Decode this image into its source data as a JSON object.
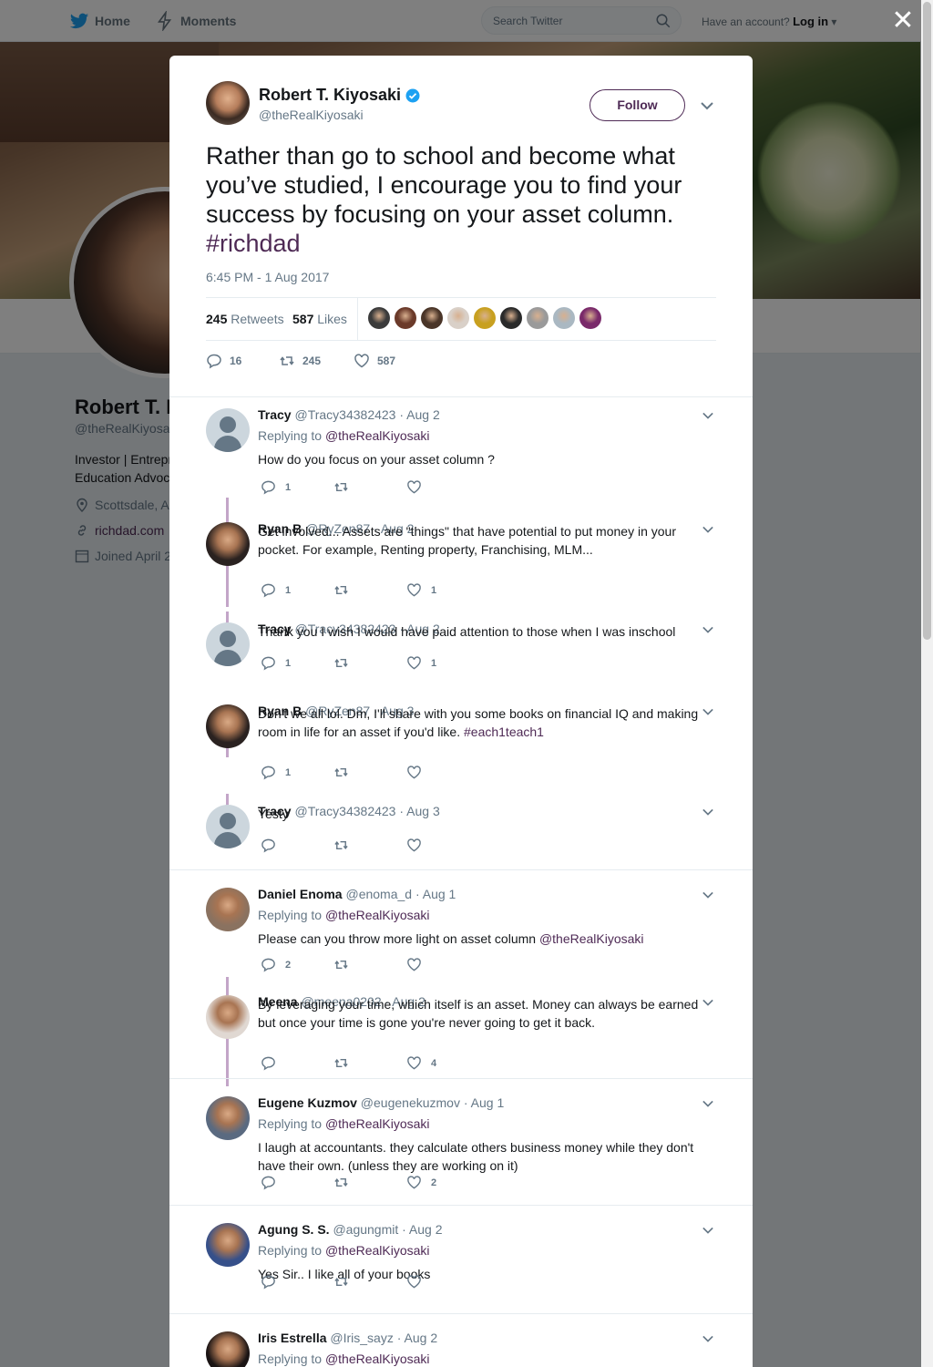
{
  "topbar": {
    "home": "Home",
    "moments": "Moments",
    "search_placeholder": "Search Twitter",
    "have_account": "Have an account?",
    "login": "Log in"
  },
  "profile": {
    "name": "Robert T. K",
    "handle": "@theRealKiyosal",
    "bio_line1": "Investor | Entrepr",
    "bio_line2": "Education Advoc",
    "location": "Scottsdale, A",
    "url": "richdad.com",
    "joined": "Joined April 2"
  },
  "main_tweet": {
    "name": "Robert T. Kiyosaki",
    "handle": "@theRealKiyosaki",
    "follow": "Follow",
    "text": "Rather than go to school and become what you’ve studied, I encourage you to find your success by focusing on your asset column.",
    "hashtag": "#richdad",
    "time": "6:45 PM - 1 Aug 2017",
    "retweets_count": "245",
    "retweets_label": "Retweets",
    "likes_count": "587",
    "likes_label": "Likes",
    "action_replies": "16",
    "action_retweets": "245",
    "action_likes": "587",
    "liker_colors": [
      "#3b3b3b",
      "#6b3a2a",
      "#4a3528",
      "#d9d0c8",
      "#c8a020",
      "#2a2a2a",
      "#9a9a9a",
      "#aab8c2",
      "#7a2a6a"
    ]
  },
  "replies": [
    {
      "name": "Tracy",
      "handle": "@Tracy34382423",
      "date": "· Aug 2",
      "replying_label": "Replying to",
      "replying_to": "@theRealKiyosaki",
      "text": "How do you focus on your asset column ?",
      "replies": "1",
      "retweets": "",
      "likes": ""
    },
    {
      "name": "Ryan B",
      "handle": "@RyZen87",
      "date": "· Aug 2",
      "text": "Get involved... Assets are \"things\" that have potential to put money in your pocket. For example, Renting property, Franchising, MLM...",
      "replies": "1",
      "retweets": "",
      "likes": "1"
    },
    {
      "name": "Tracy",
      "handle": "@Tracy34382423",
      "date": "· Aug 2",
      "text": "Thank you I wish I would have paid attention to those when I was inschool",
      "replies": "1",
      "retweets": "",
      "likes": "1"
    },
    {
      "name": "Ryan B",
      "handle": "@RyZen87",
      "date": "· Aug 3",
      "text": "Don't we all lol. Dm, I'll share with you some books on financial IQ and making room in life for an asset if you'd like.",
      "hashtag": "#each1teach1",
      "replies": "1",
      "retweets": "",
      "likes": ""
    },
    {
      "name": "Tracy",
      "handle": "@Tracy34382423",
      "date": "· Aug 3",
      "text": "Yesty",
      "replies": "",
      "retweets": "",
      "likes": ""
    },
    {
      "name": "Daniel Enoma",
      "handle": "@enoma_d",
      "date": "· Aug 1",
      "replying_label": "Replying to",
      "replying_to": "@theRealKiyosaki",
      "text": "Please can you throw more light on asset column",
      "mention": "@theRealKiyosaki",
      "replies": "2",
      "retweets": "",
      "likes": ""
    },
    {
      "name": "Meena",
      "handle": "@meena0202",
      "date": "· Aug 2",
      "text": "By leveraging your time, which itself is an asset. Money can always be earned but once your time is gone you're never going to get it back.",
      "replies": "",
      "retweets": "",
      "likes": "4"
    },
    {
      "name": "Eugene Kuzmov",
      "handle": "@eugenekuzmov",
      "date": "· Aug 1",
      "replying_label": "Replying to",
      "replying_to": "@theRealKiyosaki",
      "text": "I laugh at accountants. they calculate others business money while they don't have their own. (unless they are working on it)",
      "replies": "",
      "retweets": "",
      "likes": "2"
    },
    {
      "name": "Agung S. S.",
      "handle": "@agungmit",
      "date": "· Aug 2",
      "replying_label": "Replying to",
      "replying_to": "@theRealKiyosaki",
      "text": "Yes Sir.. I like all of your books",
      "replies": "",
      "retweets": "",
      "likes": ""
    },
    {
      "name": "Iris Estrella",
      "handle": "@Iris_sayz",
      "date": "· Aug 2",
      "replying_label": "Replying to",
      "replying_to": "@theRealKiyosaki"
    }
  ],
  "colors": {
    "accent": "#4e2a55",
    "twitter_blue": "#1da1f2",
    "muted": "#657786",
    "thread": "#c3a5c8"
  }
}
